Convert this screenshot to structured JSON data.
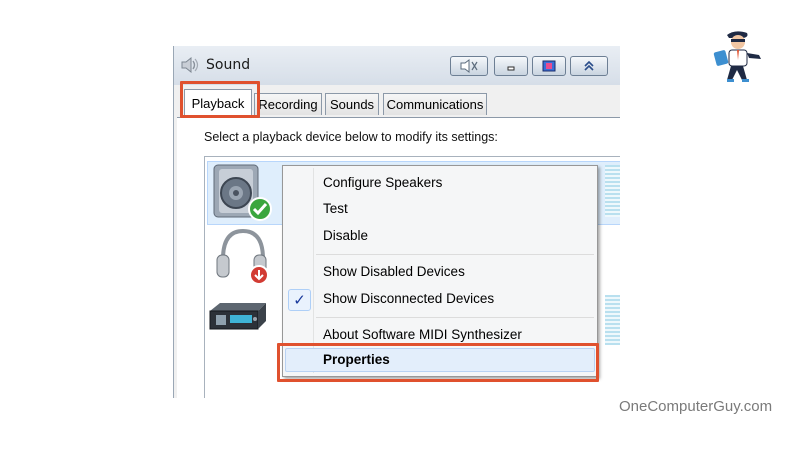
{
  "dialog": {
    "title": "Sound",
    "title_icon": "speaker-icon",
    "window_buttons": [
      "mute-icon",
      "minimize-icon",
      "color-icon",
      "collapse-icon"
    ]
  },
  "tabs": [
    {
      "label": "Playback",
      "active": true
    },
    {
      "label": "Recording",
      "active": false
    },
    {
      "label": "Sounds",
      "active": false
    },
    {
      "label": "Communications",
      "active": false
    }
  ],
  "instruction": "Select a playback device below to modify its settings:",
  "devices": [
    {
      "icon": "speaker-device-icon",
      "status_icon": "green-check-icon",
      "selected": true
    },
    {
      "icon": "headphones-device-icon",
      "status_icon": "red-down-arrow-icon",
      "selected": false
    },
    {
      "icon": "audio-interface-device-icon",
      "selected": false
    }
  ],
  "context_menu": {
    "items": [
      {
        "label": "Configure Speakers"
      },
      {
        "label": "Test"
      },
      {
        "label": "Disable"
      },
      {
        "label": "Show Disabled Devices"
      },
      {
        "label": "Show Disconnected Devices",
        "checked": true
      },
      {
        "label": "About Software MIDI Synthesizer"
      },
      {
        "label": "Properties",
        "bold": true,
        "highlighted": true
      }
    ],
    "check_glyph": "✓"
  },
  "colors": {
    "highlight_border": "#e0512e",
    "selection": "#dfeefc",
    "check": "#1a3a9c"
  },
  "watermark": "OneComputerGuy.com",
  "logo_icon": "computer-guy-logo-icon"
}
